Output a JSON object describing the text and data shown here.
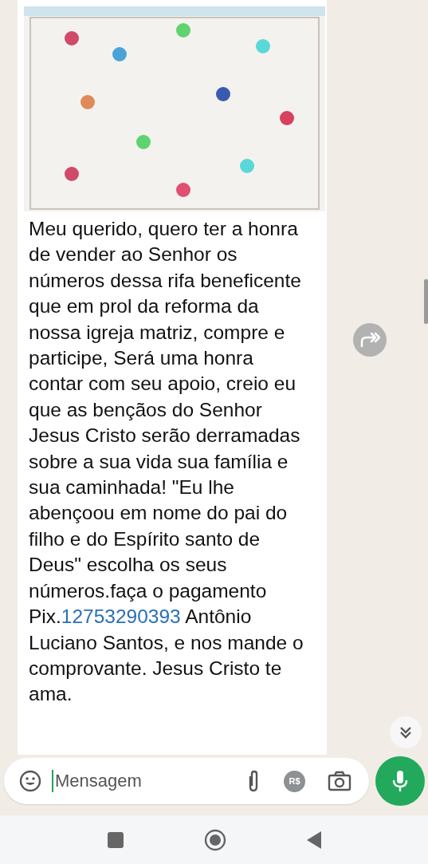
{
  "message": {
    "text_before": "Meu querido, quero ter a honra de vender ao Senhor os números dessa rifa beneficente que em prol da reforma da nossa igreja matriz, compre e participe, Será uma honra contar com seu apoio, creio eu que as bençãos do Senhor Jesus Cristo serão derramadas sobre a sua vida sua família e sua caminhada! \"Eu lhe abençoou em nome do pai do filho e do Espírito santo de Deus\" escolha os seus números.faça o pagamento Pix.",
    "phone_link": "12753290393",
    "text_after": "  Antônio Luciano Santos, e nos mande o comprovante.  Jesus Cristo te ama."
  },
  "composer": {
    "placeholder": "Mensagem",
    "payment_badge": "R$"
  }
}
